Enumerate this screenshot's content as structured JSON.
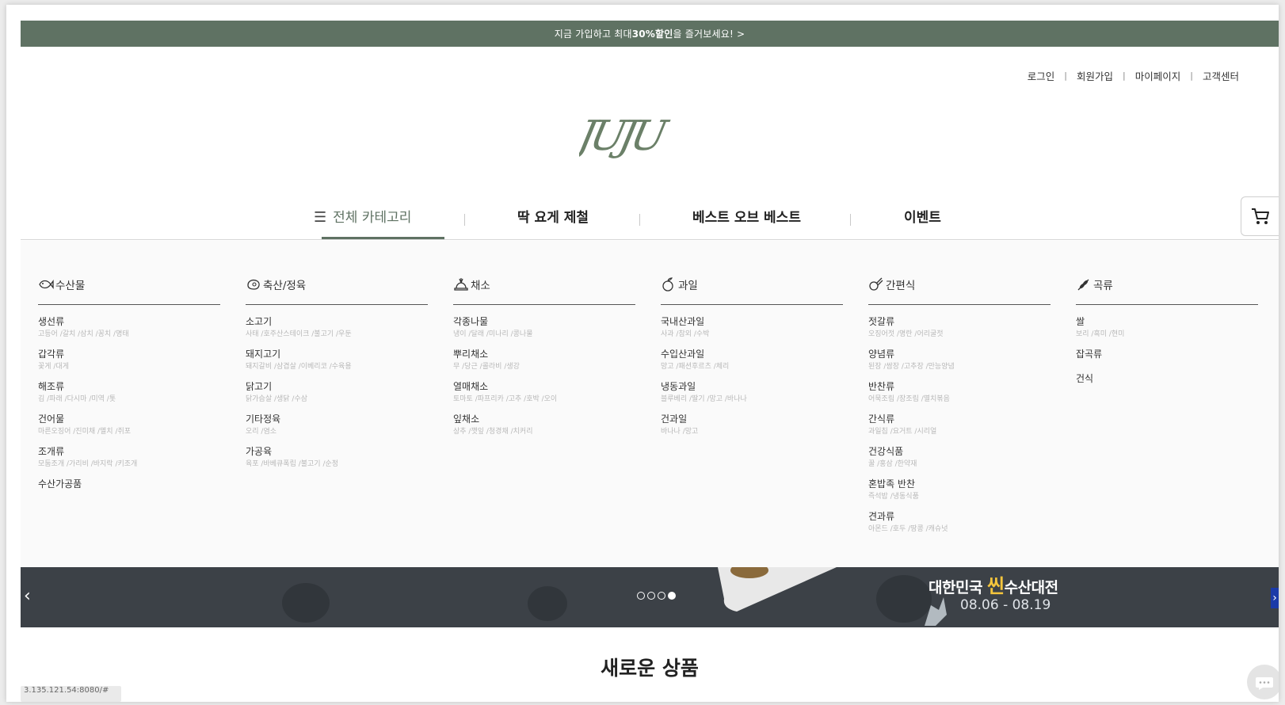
{
  "promo": {
    "text_before": "지금 가입하고 최대 ",
    "text_bold": "30%할인",
    "text_after": " 을 즐거보세요! >"
  },
  "top_links": [
    "로그인",
    "회원가입",
    "마이페이지",
    "고객센터"
  ],
  "logo_text": "JUJU",
  "nav": {
    "all_categories": "전체 카테고리",
    "items": [
      "딱 요게 제철",
      "베스트 오브 베스트",
      "이벤트"
    ]
  },
  "menu": [
    {
      "title": "수산물",
      "icon": "fish-icon",
      "cats": [
        {
          "name": "생선류",
          "sub": "고등어 /갈치 /삼치 /꽁치 /명태"
        },
        {
          "name": "갑각류",
          "sub": "꽃게 /대게"
        },
        {
          "name": "해조류",
          "sub": "김 /파래 /다시마 /미역 /톳"
        },
        {
          "name": "건어물",
          "sub": "마른오징어 /진미채 /멸치 /쥐포"
        },
        {
          "name": "조개류",
          "sub": "모둠조개 /가리비 /바지락 /키조개"
        },
        {
          "name": "수산가공품",
          "sub": ""
        }
      ]
    },
    {
      "title": "축산/정육",
      "icon": "meat-icon",
      "cats": [
        {
          "name": "소고기",
          "sub": "사태 /호주산스테이크 /불고기 /우둔"
        },
        {
          "name": "돼지고기",
          "sub": "돼지갈비 /삼겹살 /이베리코 /수육용"
        },
        {
          "name": "닭고기",
          "sub": "닭가슴살 /생닭 /수삼"
        },
        {
          "name": "기타정육",
          "sub": "오리 /염소"
        },
        {
          "name": "가공육",
          "sub": "육포 /바베큐폭립 /불고기 /순정"
        }
      ]
    },
    {
      "title": "채소",
      "icon": "vegetable-icon",
      "cats": [
        {
          "name": "각종나물",
          "sub": "냉이 /달래 /미나리 /콩나물"
        },
        {
          "name": "뿌리채소",
          "sub": "무 /당근 /콜라비 /생강"
        },
        {
          "name": "열매채소",
          "sub": "토마토 /파프리카 /고추 /호박 /오이"
        },
        {
          "name": "잎채소",
          "sub": "상추 /깻잎 /청경채 /치커리"
        }
      ]
    },
    {
      "title": "과일",
      "icon": "fruit-icon",
      "cats": [
        {
          "name": "국내산과일",
          "sub": "사과 /참외 /수박"
        },
        {
          "name": "수입산과일",
          "sub": "망고 /패션후르츠 /체리"
        },
        {
          "name": "냉동과일",
          "sub": "블루베리 /딸기 /망고 /바나나"
        },
        {
          "name": "건과일",
          "sub": "바나나 /망고"
        }
      ]
    },
    {
      "title": "간편식",
      "icon": "snack-icon",
      "cats": [
        {
          "name": "젓갈류",
          "sub": "오징어젓 /명란 /어리굴젓"
        },
        {
          "name": "양념류",
          "sub": "된장 /쌈장 /고추장 /만능양념"
        },
        {
          "name": "반찬류",
          "sub": "어묵조림 /장조림 /멸치볶음"
        },
        {
          "name": "간식류",
          "sub": "과일칩 /요거트 /시리얼"
        },
        {
          "name": "건강식품",
          "sub": "꿀 /홍삼 /한약재"
        },
        {
          "name": "혼밥족 반찬",
          "sub": "즉석밥 /냉동식품"
        },
        {
          "name": "견과류",
          "sub": "아몬드 /호두 /땅콩 /캐슈넛"
        }
      ]
    },
    {
      "title": "곡류",
      "icon": "grain-icon",
      "cats": [
        {
          "name": "쌀",
          "sub": "보리 /흑미 /현미"
        },
        {
          "name": "잡곡류",
          "sub": ""
        },
        {
          "name": "건식",
          "sub": ""
        }
      ]
    }
  ],
  "banner": {
    "line1_before": "대한민국 ",
    "line1_accent": "씬",
    "line1_after": "수산대전",
    "line2": "08.06 - 08.19",
    "dots": 4,
    "active_dot": 3,
    "prev": "‹",
    "next": "›"
  },
  "new_products_title": "새로운 상품",
  "ip_text": "3.135.121.54:8080/#"
}
